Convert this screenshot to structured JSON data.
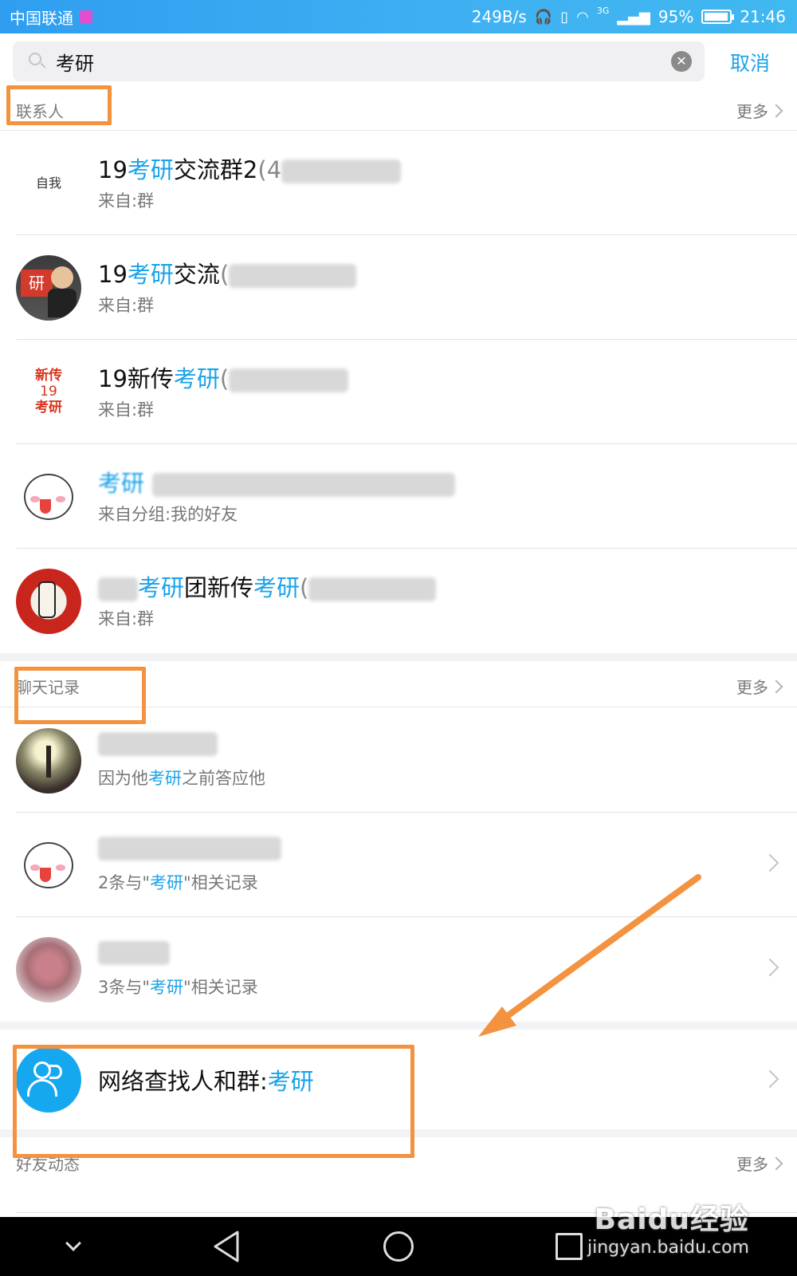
{
  "status_bar": {
    "carrier": "中国联通",
    "net_speed": "249B/s",
    "network_type": "3G",
    "battery_percent": "95%",
    "battery_level": 0.95,
    "time": "21:46"
  },
  "search": {
    "query": "考研",
    "cancel_label": "取消"
  },
  "contacts_section": {
    "title": "联系人",
    "more_label": "更多",
    "items": [
      {
        "name_pre": "19",
        "name_hl": "考研",
        "name_post": "交流群2",
        "name_tail": "(4",
        "source": "来自:群",
        "avatar_text": "自我"
      },
      {
        "name_pre": "19",
        "name_hl": "考研",
        "name_post": "交流",
        "name_tail": "(",
        "source": "来自:群",
        "avatar_text": "研"
      },
      {
        "name_pre": "19新传",
        "name_hl": "考研",
        "name_post": "",
        "name_tail": "(",
        "source": "来自:群",
        "avatar_lines": [
          "新传",
          "19",
          "考研"
        ]
      },
      {
        "name_pre": "",
        "name_hl": "考研",
        "name_post": "",
        "name_tail": "",
        "source": "来自分组:我的好友"
      },
      {
        "name_pre": "",
        "name_hl": "考研",
        "name_post": "团新传",
        "name_hl2": "考研",
        "name_tail": "(",
        "source": "来自:群"
      }
    ]
  },
  "chat_section": {
    "title": "聊天记录",
    "more_label": "更多",
    "items": [
      {
        "snippet_pre": "因为他",
        "snippet_hl": "考研",
        "snippet_post": "之前答应他"
      },
      {
        "snippet_pre": "2条与\"",
        "snippet_hl": "考研",
        "snippet_post": "\"相关记录"
      },
      {
        "snippet_pre": "3条与\"",
        "snippet_hl": "考研",
        "snippet_post": "\"相关记录"
      }
    ]
  },
  "network_search": {
    "label": "网络查找人和群:",
    "keyword": "考研"
  },
  "friends_section": {
    "title": "好友动态",
    "more_label": "更多"
  },
  "watermark": {
    "brand": "Baidu经验",
    "url": "jingyan.baidu.com"
  },
  "colors": {
    "accent": "#1aa3e8",
    "annotation": "#f3923f",
    "status_bar": "#3aa9f0"
  }
}
